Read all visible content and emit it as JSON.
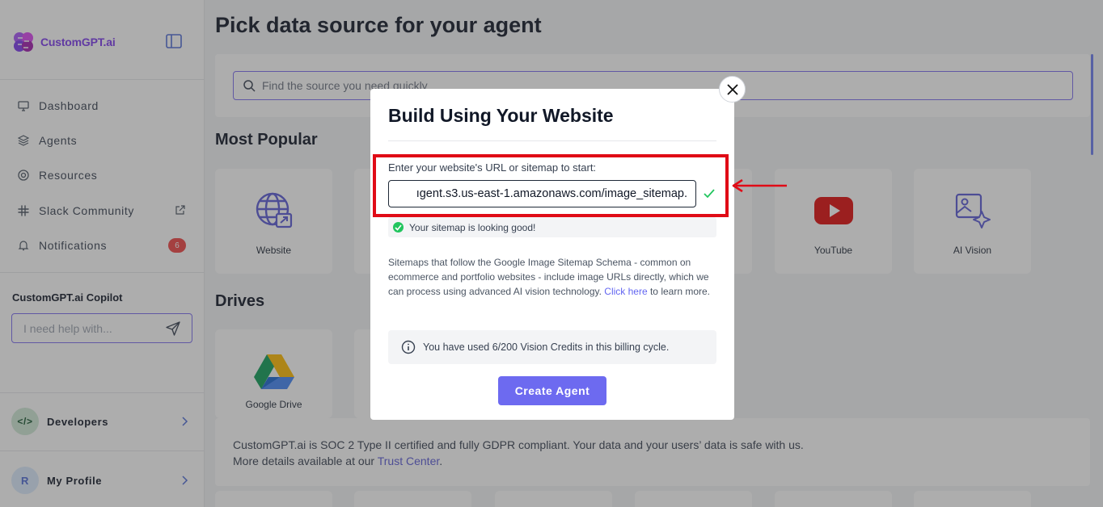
{
  "app": {
    "name": "CustomGPT.ai"
  },
  "sidebar": {
    "items": [
      {
        "label": "Dashboard",
        "icon": "monitor-icon"
      },
      {
        "label": "Agents",
        "icon": "layers-icon"
      },
      {
        "label": "Resources",
        "icon": "lifebuoy-icon"
      },
      {
        "label": "Slack Community",
        "icon": "slack-icon"
      },
      {
        "label": "Notifications",
        "icon": "bell-icon",
        "badge": "6"
      }
    ],
    "copilot": {
      "title": "CustomGPT.ai Copilot",
      "placeholder": "I need help with..."
    },
    "developers": {
      "label": "Developers",
      "icon_text": "</>"
    },
    "profile": {
      "label": "My Profile",
      "initial": "R"
    }
  },
  "main": {
    "title": "Pick data source for your agent",
    "search_placeholder": "Find the source you need quickly",
    "sections": {
      "popular": "Most Popular",
      "drives": "Drives"
    },
    "cards": [
      {
        "label": "Website",
        "icon": "globe-icon"
      },
      {
        "label": "YouTube",
        "icon": "youtube-icon"
      },
      {
        "label": "AI Vision",
        "icon": "ai-vision-icon"
      },
      {
        "label": "Google Drive",
        "icon": "google-drive-icon"
      }
    ],
    "notice": {
      "line1": "CustomGPT.ai is SOC 2 Type II certified and fully GDPR compliant. Your data and your users’ data is safe with us.",
      "line2_prefix": "More details available at our ",
      "link": "Trust Center",
      "line2_suffix": "."
    }
  },
  "modal": {
    "title": "Build Using Your Website",
    "url_label": "Enter your website's URL or sitemap to start:",
    "url_value": "ıgent.s3.us-east-1.amazonaws.com/image_sitemap.",
    "success": "Your sitemap is looking good!",
    "description": "Sitemaps that follow the Google Image Sitemap Schema - common on ecommerce and portfolio websites - include image URLs directly, which we can process using advanced AI vision technology. ",
    "link_text": "Click here",
    "description_suffix": " to learn more.",
    "credits": "You have used 6/200 Vision Credits in this billing cycle.",
    "button": "Create Agent"
  },
  "colors": {
    "accent": "#6d6af0",
    "highlight": "#e00b16",
    "success": "#22c55e",
    "badge": "#ef4444"
  }
}
